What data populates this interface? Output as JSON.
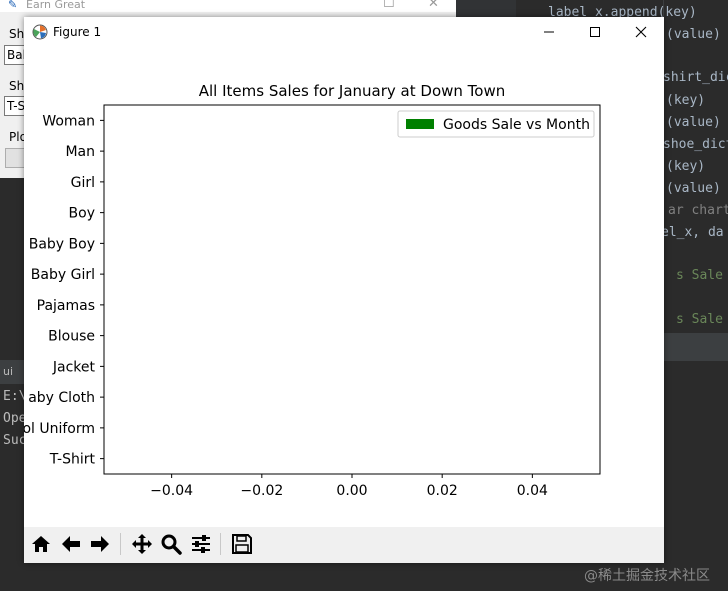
{
  "ide": {
    "lines": [
      {
        "text": "label_x.append(key)",
        "kind": "code"
      },
      {
        "text": "(value)",
        "kind": "code"
      },
      {
        "text": "shirt_dic",
        "kind": "code"
      },
      {
        "text": "(key)",
        "kind": "code"
      },
      {
        "text": "(value)",
        "kind": "code"
      },
      {
        "text": "shoe_dict",
        "kind": "code"
      },
      {
        "text": "(key)",
        "kind": "code"
      },
      {
        "text": "(value)",
        "kind": "code"
      },
      {
        "text": "ar chart",
        "kind": "comment"
      },
      {
        "text": "el_x, da",
        "kind": "code"
      },
      {
        "text": "s Sale vs",
        "kind": "str"
      },
      {
        "text": "s Sale vs",
        "kind": "str"
      }
    ]
  },
  "tkwin": {
    "title": "Earn Great",
    "label1": "Sh",
    "box1": "Bab",
    "label2": "Sh",
    "box2": "T-S",
    "label3": "Plo"
  },
  "console": {
    "tab": "ui",
    "lines": [
      "E:\\",
      "Ope",
      "Suc"
    ]
  },
  "figure": {
    "title": "Figure 1",
    "toolbar": {
      "home": "home-icon",
      "back": "arrow-left-icon",
      "forward": "arrow-right-icon",
      "pan": "move-icon",
      "zoom": "zoom-icon",
      "configure": "sliders-icon",
      "save": "save-icon"
    }
  },
  "chart_data": {
    "type": "bar",
    "orientation": "horizontal",
    "title": "All Items Sales for January at Down Town",
    "categories": [
      "T-Shirt",
      "ol Uniform",
      "aby Cloth",
      "Jacket",
      "Blouse",
      "Pajamas",
      "Baby Girl",
      "Baby Boy",
      "Boy",
      "Girl",
      "Man",
      "Woman"
    ],
    "series": [
      {
        "name": "Goods Sale vs Month",
        "values": [
          0,
          0,
          0,
          0,
          0,
          0,
          0,
          0,
          0,
          0,
          0,
          0
        ],
        "color": "#008000"
      }
    ],
    "xticks": [
      "−0.04",
      "−0.02",
      "0.00",
      "0.02",
      "0.04"
    ],
    "xlim": [
      -0.055,
      0.055
    ],
    "legend_position": "top-right",
    "grid": false
  },
  "watermark": "@稀土掘金技术社区"
}
